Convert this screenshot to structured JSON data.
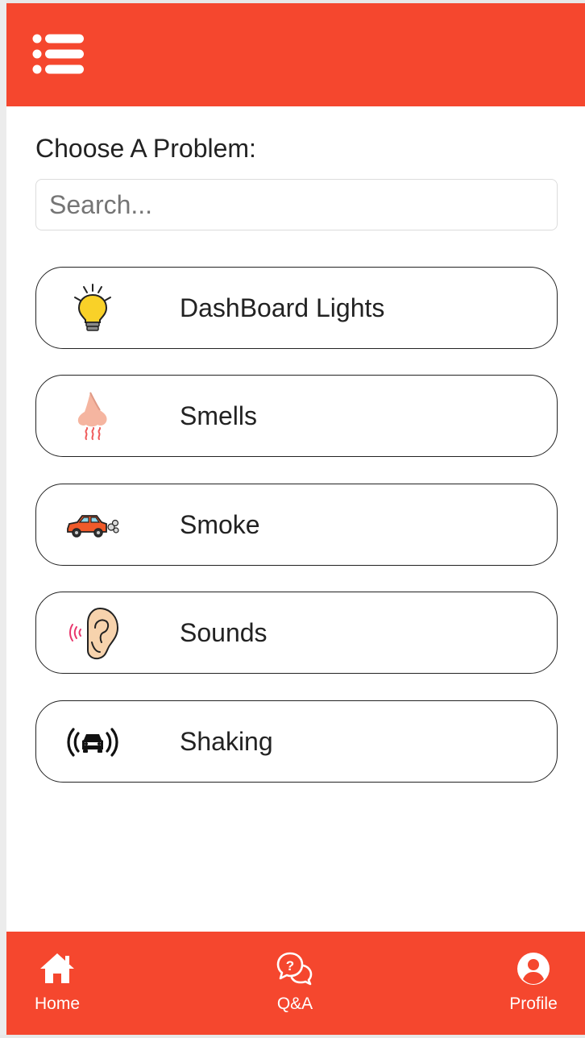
{
  "header": {
    "menu_icon": "list-menu-icon"
  },
  "main": {
    "prompt": "Choose A Problem:",
    "search_placeholder": "Search...",
    "problems": [
      {
        "label": "DashBoard Lights",
        "icon": "light-bulb-icon"
      },
      {
        "label": "Smells",
        "icon": "nose-icon"
      },
      {
        "label": "Smoke",
        "icon": "smoking-car-icon"
      },
      {
        "label": "Sounds",
        "icon": "ear-icon"
      },
      {
        "label": "Shaking",
        "icon": "vibrating-car-icon"
      }
    ]
  },
  "bottom_nav": [
    {
      "label": "Home",
      "icon": "home-icon"
    },
    {
      "label": "Q&A",
      "icon": "chat-question-icon"
    },
    {
      "label": "Profile",
      "icon": "user-circle-icon"
    }
  ],
  "colors": {
    "brand": "#f5472e",
    "text": "#222222",
    "border": "#222222"
  }
}
